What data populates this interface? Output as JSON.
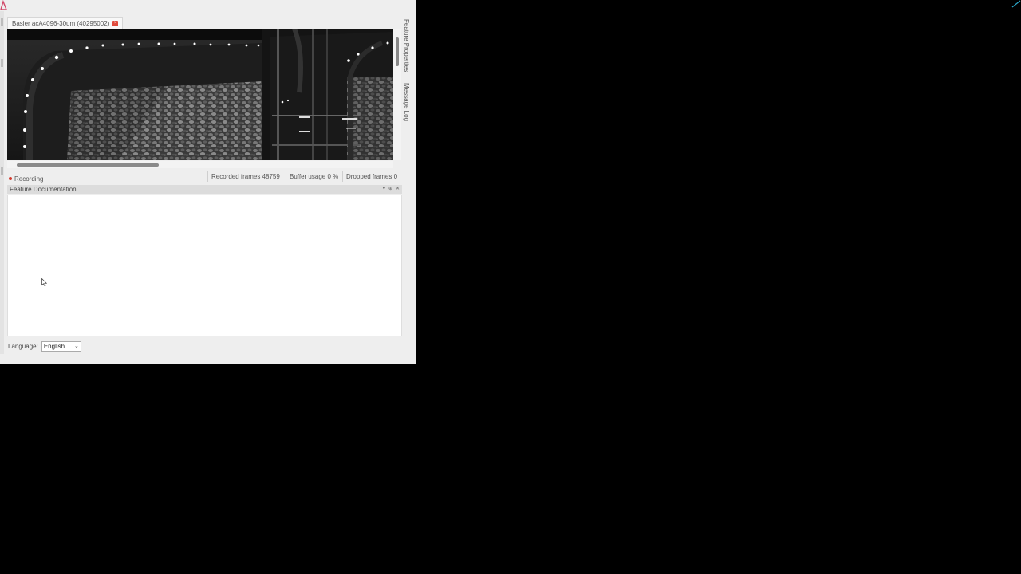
{
  "window": {
    "tab_title": "Basler acA4096-30um (40295002)",
    "side_tabs": [
      "Feature Properties",
      "Message Log"
    ]
  },
  "status": {
    "recording_label": "Recording",
    "recorded_frames": "Recorded frames 48759",
    "buffer_usage": "Buffer usage 0 %",
    "dropped_frames": "Dropped frames 0"
  },
  "feature_documentation": {
    "title": "Feature Documentation"
  },
  "language": {
    "label": "Language:",
    "selected": "English"
  },
  "icons": {
    "app": "app-corner-icon",
    "close_tab": "close-icon",
    "panel_dropdown": "chevron-down-icon",
    "panel_pin": "pin-icon",
    "panel_close": "close-icon",
    "select_arrow": "chevron-down-icon",
    "cursor": "mouse-cursor-icon",
    "corner": "arrow-icon"
  },
  "colors": {
    "background": "#000000",
    "window": "#eeeeee",
    "recording_dot": "#d23a2e",
    "close_badge": "#e04a3c",
    "corner_arrow": "#2aa7c9"
  }
}
